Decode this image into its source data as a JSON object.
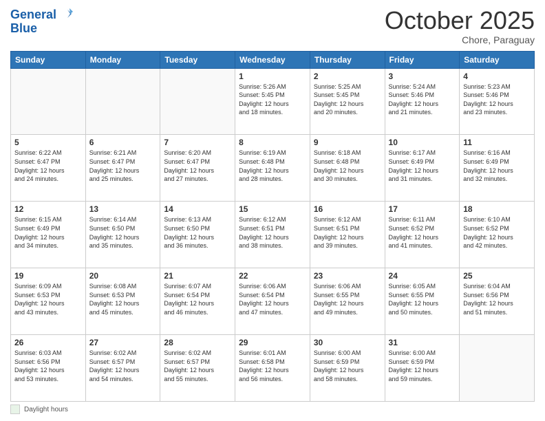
{
  "header": {
    "logo_general": "General",
    "logo_blue": "Blue",
    "month": "October 2025",
    "location": "Chore, Paraguay"
  },
  "days_of_week": [
    "Sunday",
    "Monday",
    "Tuesday",
    "Wednesday",
    "Thursday",
    "Friday",
    "Saturday"
  ],
  "weeks": [
    [
      {
        "day": "",
        "info": ""
      },
      {
        "day": "",
        "info": ""
      },
      {
        "day": "",
        "info": ""
      },
      {
        "day": "1",
        "info": "Sunrise: 5:26 AM\nSunset: 5:45 PM\nDaylight: 12 hours\nand 18 minutes."
      },
      {
        "day": "2",
        "info": "Sunrise: 5:25 AM\nSunset: 5:45 PM\nDaylight: 12 hours\nand 20 minutes."
      },
      {
        "day": "3",
        "info": "Sunrise: 5:24 AM\nSunset: 5:46 PM\nDaylight: 12 hours\nand 21 minutes."
      },
      {
        "day": "4",
        "info": "Sunrise: 5:23 AM\nSunset: 5:46 PM\nDaylight: 12 hours\nand 23 minutes."
      }
    ],
    [
      {
        "day": "5",
        "info": "Sunrise: 6:22 AM\nSunset: 6:47 PM\nDaylight: 12 hours\nand 24 minutes."
      },
      {
        "day": "6",
        "info": "Sunrise: 6:21 AM\nSunset: 6:47 PM\nDaylight: 12 hours\nand 25 minutes."
      },
      {
        "day": "7",
        "info": "Sunrise: 6:20 AM\nSunset: 6:47 PM\nDaylight: 12 hours\nand 27 minutes."
      },
      {
        "day": "8",
        "info": "Sunrise: 6:19 AM\nSunset: 6:48 PM\nDaylight: 12 hours\nand 28 minutes."
      },
      {
        "day": "9",
        "info": "Sunrise: 6:18 AM\nSunset: 6:48 PM\nDaylight: 12 hours\nand 30 minutes."
      },
      {
        "day": "10",
        "info": "Sunrise: 6:17 AM\nSunset: 6:49 PM\nDaylight: 12 hours\nand 31 minutes."
      },
      {
        "day": "11",
        "info": "Sunrise: 6:16 AM\nSunset: 6:49 PM\nDaylight: 12 hours\nand 32 minutes."
      }
    ],
    [
      {
        "day": "12",
        "info": "Sunrise: 6:15 AM\nSunset: 6:49 PM\nDaylight: 12 hours\nand 34 minutes."
      },
      {
        "day": "13",
        "info": "Sunrise: 6:14 AM\nSunset: 6:50 PM\nDaylight: 12 hours\nand 35 minutes."
      },
      {
        "day": "14",
        "info": "Sunrise: 6:13 AM\nSunset: 6:50 PM\nDaylight: 12 hours\nand 36 minutes."
      },
      {
        "day": "15",
        "info": "Sunrise: 6:12 AM\nSunset: 6:51 PM\nDaylight: 12 hours\nand 38 minutes."
      },
      {
        "day": "16",
        "info": "Sunrise: 6:12 AM\nSunset: 6:51 PM\nDaylight: 12 hours\nand 39 minutes."
      },
      {
        "day": "17",
        "info": "Sunrise: 6:11 AM\nSunset: 6:52 PM\nDaylight: 12 hours\nand 41 minutes."
      },
      {
        "day": "18",
        "info": "Sunrise: 6:10 AM\nSunset: 6:52 PM\nDaylight: 12 hours\nand 42 minutes."
      }
    ],
    [
      {
        "day": "19",
        "info": "Sunrise: 6:09 AM\nSunset: 6:53 PM\nDaylight: 12 hours\nand 43 minutes."
      },
      {
        "day": "20",
        "info": "Sunrise: 6:08 AM\nSunset: 6:53 PM\nDaylight: 12 hours\nand 45 minutes."
      },
      {
        "day": "21",
        "info": "Sunrise: 6:07 AM\nSunset: 6:54 PM\nDaylight: 12 hours\nand 46 minutes."
      },
      {
        "day": "22",
        "info": "Sunrise: 6:06 AM\nSunset: 6:54 PM\nDaylight: 12 hours\nand 47 minutes."
      },
      {
        "day": "23",
        "info": "Sunrise: 6:06 AM\nSunset: 6:55 PM\nDaylight: 12 hours\nand 49 minutes."
      },
      {
        "day": "24",
        "info": "Sunrise: 6:05 AM\nSunset: 6:55 PM\nDaylight: 12 hours\nand 50 minutes."
      },
      {
        "day": "25",
        "info": "Sunrise: 6:04 AM\nSunset: 6:56 PM\nDaylight: 12 hours\nand 51 minutes."
      }
    ],
    [
      {
        "day": "26",
        "info": "Sunrise: 6:03 AM\nSunset: 6:56 PM\nDaylight: 12 hours\nand 53 minutes."
      },
      {
        "day": "27",
        "info": "Sunrise: 6:02 AM\nSunset: 6:57 PM\nDaylight: 12 hours\nand 54 minutes."
      },
      {
        "day": "28",
        "info": "Sunrise: 6:02 AM\nSunset: 6:57 PM\nDaylight: 12 hours\nand 55 minutes."
      },
      {
        "day": "29",
        "info": "Sunrise: 6:01 AM\nSunset: 6:58 PM\nDaylight: 12 hours\nand 56 minutes."
      },
      {
        "day": "30",
        "info": "Sunrise: 6:00 AM\nSunset: 6:59 PM\nDaylight: 12 hours\nand 58 minutes."
      },
      {
        "day": "31",
        "info": "Sunrise: 6:00 AM\nSunset: 6:59 PM\nDaylight: 12 hours\nand 59 minutes."
      },
      {
        "day": "",
        "info": ""
      }
    ]
  ],
  "footer": {
    "daylight_label": "Daylight hours"
  }
}
